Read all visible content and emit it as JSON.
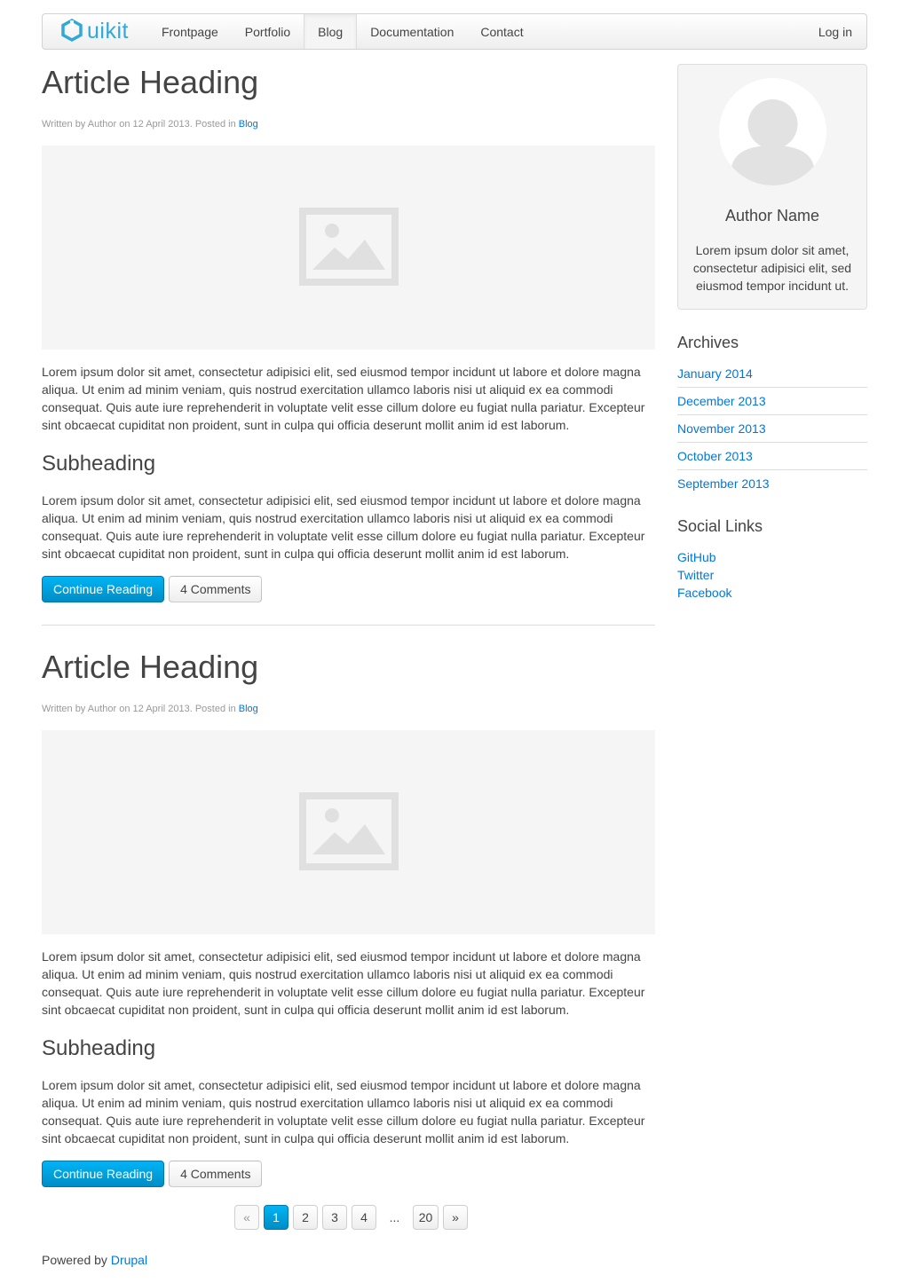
{
  "navbar": {
    "brand": "uikit",
    "items": [
      {
        "label": "Frontpage"
      },
      {
        "label": "Portfolio"
      },
      {
        "label": "Blog"
      },
      {
        "label": "Documentation"
      },
      {
        "label": "Contact"
      }
    ],
    "login_label": "Log in",
    "active_item": "Blog"
  },
  "articles": [
    {
      "heading": "Article Heading",
      "meta_prefix": "Written by Author on 12 April 2013. Posted in ",
      "meta_category": "Blog",
      "paragraph1": "Lorem ipsum dolor sit amet, consectetur adipisici elit, sed eiusmod tempor incidunt ut labore et dolore magna aliqua. Ut enim ad minim veniam, quis nostrud exercitation ullamco laboris nisi ut aliquid ex ea commodi consequat. Quis aute iure reprehenderit in voluptate velit esse cillum dolore eu fugiat nulla pariatur. Excepteur sint obcaecat cupiditat non proident, sunt in culpa qui officia deserunt mollit anim id est laborum.",
      "subheading": "Subheading",
      "paragraph2": "Lorem ipsum dolor sit amet, consectetur adipisici elit, sed eiusmod tempor incidunt ut labore et dolore magna aliqua. Ut enim ad minim veniam, quis nostrud exercitation ullamco laboris nisi ut aliquid ex ea commodi consequat. Quis aute iure reprehenderit in voluptate velit esse cillum dolore eu fugiat nulla pariatur. Excepteur sint obcaecat cupiditat non proident, sunt in culpa qui officia deserunt mollit anim id est laborum.",
      "continue_label": "Continue Reading",
      "comments_label": "4 Comments"
    },
    {
      "heading": "Article Heading",
      "meta_prefix": "Written by Author on 12 April 2013. Posted in ",
      "meta_category": "Blog",
      "paragraph1": "Lorem ipsum dolor sit amet, consectetur adipisici elit, sed eiusmod tempor incidunt ut labore et dolore magna aliqua. Ut enim ad minim veniam, quis nostrud exercitation ullamco laboris nisi ut aliquid ex ea commodi consequat. Quis aute iure reprehenderit in voluptate velit esse cillum dolore eu fugiat nulla pariatur. Excepteur sint obcaecat cupiditat non proident, sunt in culpa qui officia deserunt mollit anim id est laborum.",
      "subheading": "Subheading",
      "paragraph2": "Lorem ipsum dolor sit amet, consectetur adipisici elit, sed eiusmod tempor incidunt ut labore et dolore magna aliqua. Ut enim ad minim veniam, quis nostrud exercitation ullamco laboris nisi ut aliquid ex ea commodi consequat. Quis aute iure reprehenderit in voluptate velit esse cillum dolore eu fugiat nulla pariatur. Excepteur sint obcaecat cupiditat non proident, sunt in culpa qui officia deserunt mollit anim id est laborum.",
      "continue_label": "Continue Reading",
      "comments_label": "4 Comments"
    }
  ],
  "pagination": {
    "prev": "«",
    "pages": [
      "1",
      "2",
      "3",
      "4"
    ],
    "ellipsis": "...",
    "last": "20",
    "next": "»",
    "current": "1"
  },
  "footer": {
    "prefix": "Powered by ",
    "link": "Drupal"
  },
  "sidebar": {
    "author_name": "Author Name",
    "author_bio": "Lorem ipsum dolor sit amet, consectetur adipisici elit, sed eiusmod tempor incidunt ut.",
    "archives_title": "Archives",
    "archives": [
      "January 2014",
      "December 2013",
      "November 2013",
      "October 2013",
      "September 2013"
    ],
    "social_title": "Social Links",
    "social": [
      "GitHub",
      "Twitter",
      "Facebook"
    ]
  },
  "colors": {
    "accent": "#0077dd",
    "brand": "#30a9d8",
    "primary_button": "#00a8e6",
    "placeholder_bg": "#f5f5f5",
    "placeholder_icon": "#e0e0e0"
  },
  "icons": {
    "logo": "uikit-hexagon-logo",
    "image_placeholder": "image-placeholder-icon",
    "avatar": "user-avatar-placeholder"
  }
}
